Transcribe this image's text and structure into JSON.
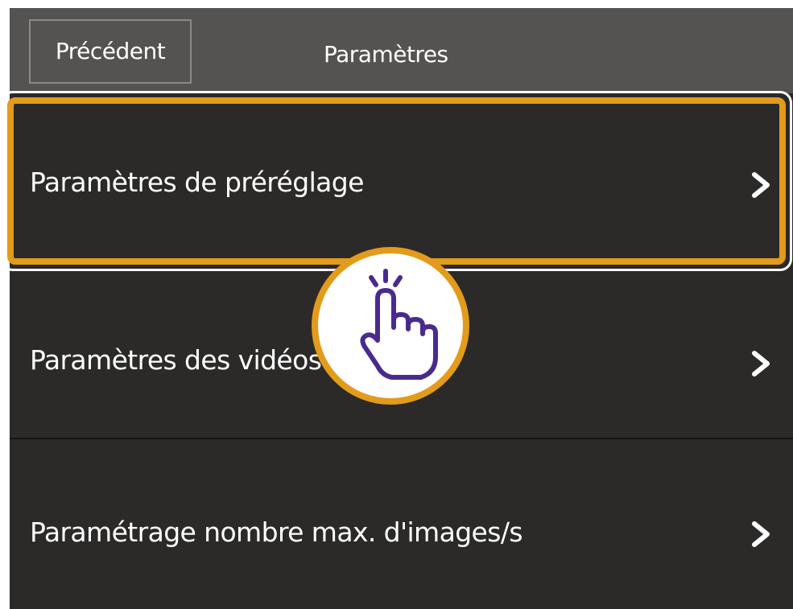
{
  "header": {
    "back_label": "Précédent",
    "title": "Paramètres"
  },
  "menu": {
    "items": [
      {
        "label": "Paramètres de préréglage",
        "icon": "chevron-right-icon"
      },
      {
        "label": "Paramètres des vidéos                 es",
        "icon": "chevron-right-icon"
      },
      {
        "label": "Paramétrage nombre max. d'images/s",
        "icon": "chevron-right-icon"
      }
    ]
  },
  "overlay": {
    "tap_icon": "tap-finger-icon",
    "highlighted_item": "Paramètres de préréglage"
  },
  "colors": {
    "header_bg": "#545352",
    "list_bg": "#2b2a29",
    "text": "#ffffff",
    "highlight": "#e39b1b",
    "tap_icon": "#4b2a8f"
  }
}
